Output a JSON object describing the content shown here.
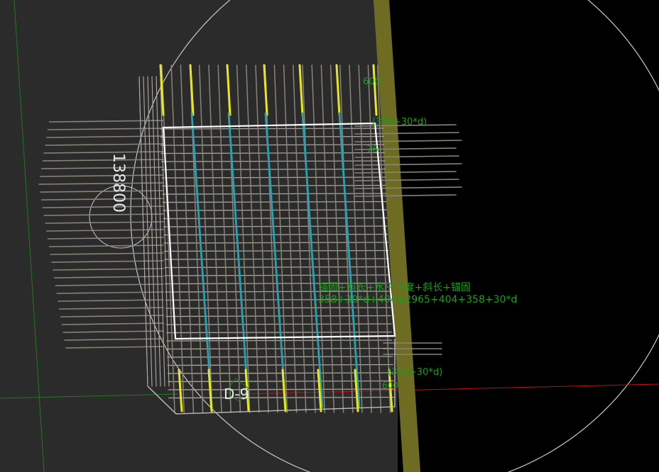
{
  "viewport": {
    "colors": {
      "background_left": "#2b2b2b",
      "background_right": "#000000",
      "column": "#6e6b22",
      "rebar_main": "#8a8478",
      "rebar_cyan": "#2aa0b0",
      "rebar_yellow": "#e8e81a",
      "frame": "#ffffff",
      "annotation": "#18a018",
      "axis_green": "#1e7a1e",
      "axis_red": "#c01010",
      "circle": "#c8c8c8"
    }
  },
  "labels": {
    "elevation": "138800",
    "element_id": "D-9"
  },
  "annotations": {
    "top_length": "600",
    "top_anchor": "(358+30*d)",
    "right_small": "76",
    "formula_label": "锚固+斜长+水平长度+斜长+锚固",
    "formula_values": "358+30*d+404+2965+404+358+30*d",
    "bottom_anchor": "(358+30*d)",
    "bottom_small": "600"
  }
}
